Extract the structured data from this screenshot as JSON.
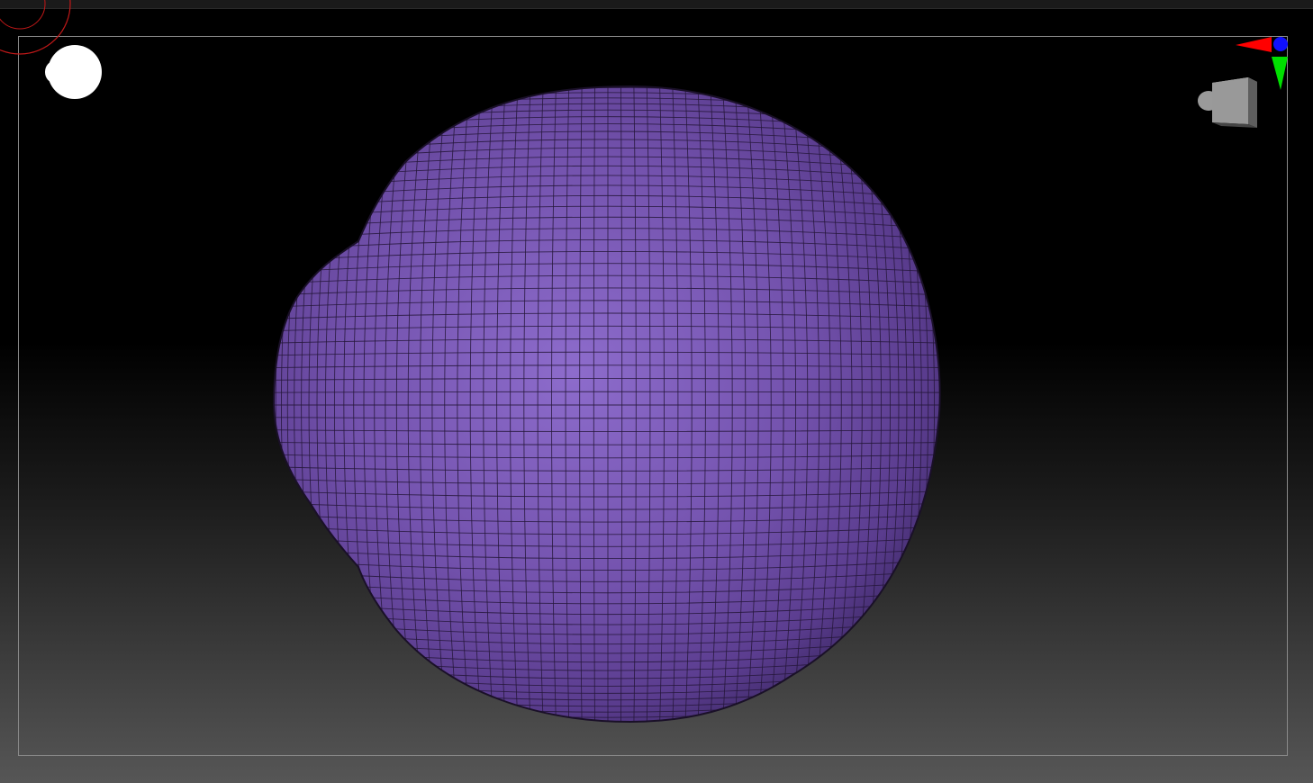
{
  "app": {
    "view": "3D viewport"
  },
  "colors": {
    "mesh_light": "#8a68c8",
    "mesh_mid": "#6e4ea8",
    "mesh_dark": "#2a1a44",
    "wire": "#1f1430",
    "brush_ring": "#c01818",
    "axis_x": "#ff0000",
    "axis_y": "#00e000",
    "axis_z": "#1010ff",
    "frame": "#8a8a8a"
  },
  "icons": {
    "brush_cursor": "brush-radius-cursor",
    "color_swatch": "white-color-swatch",
    "gizmo_cube": "navigation-cube",
    "axes": "axis-gizmo"
  }
}
